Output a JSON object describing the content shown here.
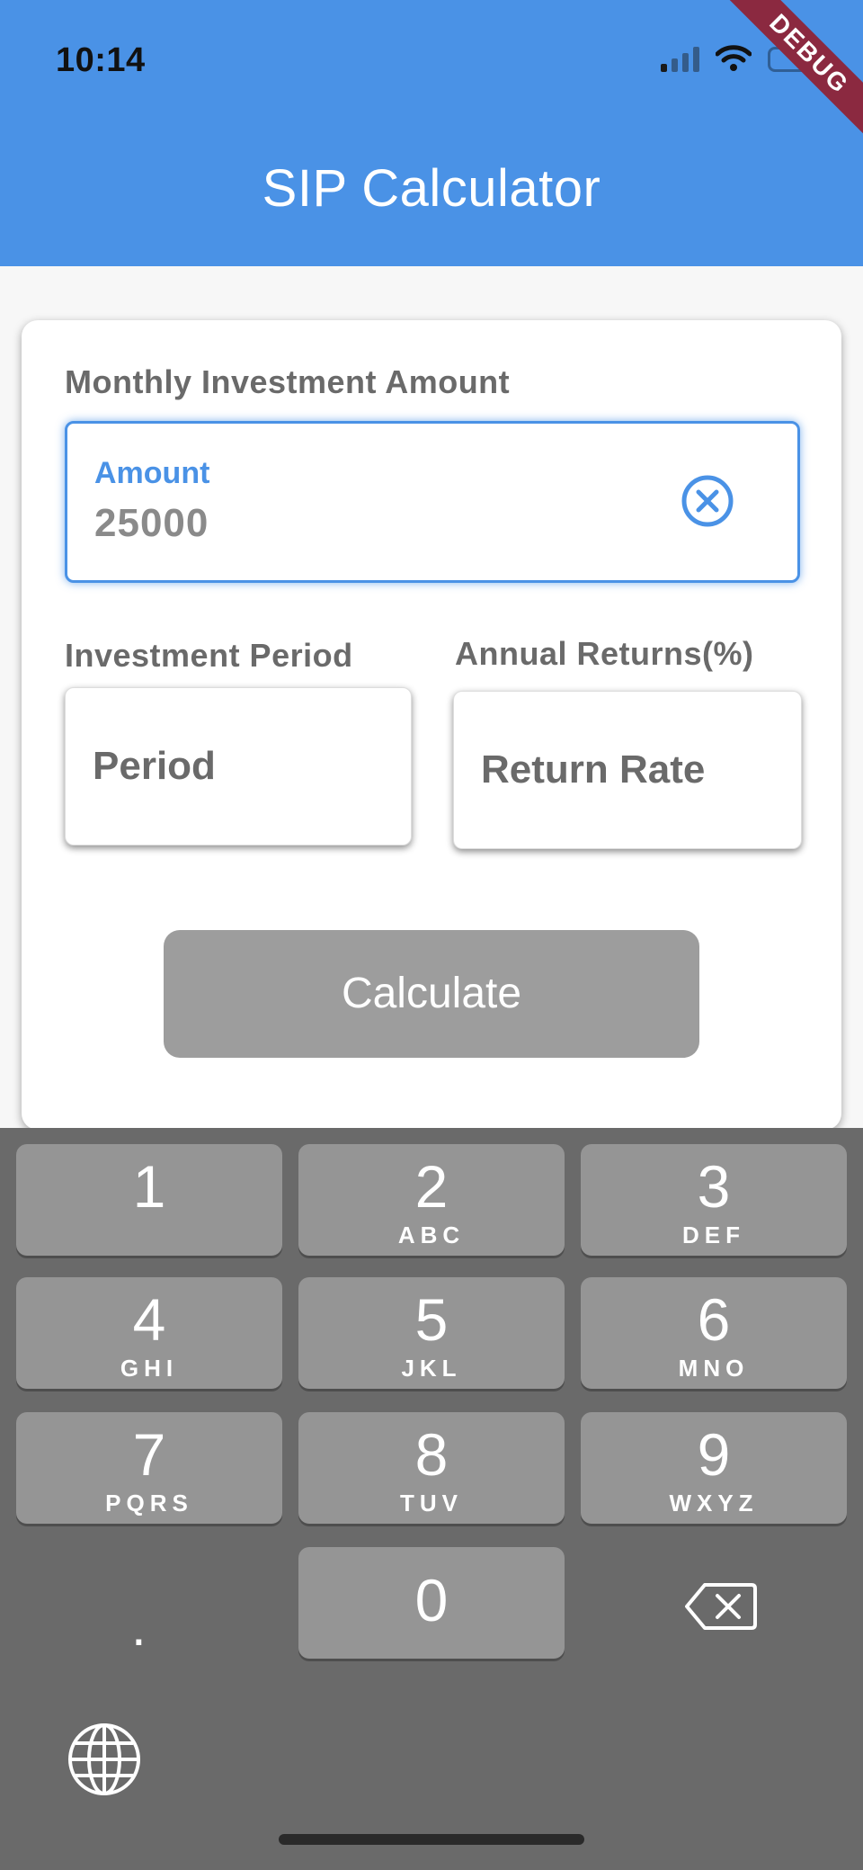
{
  "status_bar": {
    "time": "10:14"
  },
  "debug_banner": "DEBUG",
  "app_bar": {
    "title": "SIP Calculator"
  },
  "form": {
    "monthly_label": "Monthly Investment Amount",
    "amount_field": {
      "label": "Amount",
      "value": "25000"
    },
    "period_label": "Investment Period",
    "period_field": {
      "placeholder": "Period"
    },
    "returns_label": "Annual Returns(%)",
    "returns_field": {
      "placeholder": "Return Rate"
    },
    "calculate_label": "Calculate"
  },
  "keyboard": {
    "keys": [
      {
        "digit": "1",
        "letters": ""
      },
      {
        "digit": "2",
        "letters": "ABC"
      },
      {
        "digit": "3",
        "letters": "DEF"
      },
      {
        "digit": "4",
        "letters": "GHI"
      },
      {
        "digit": "5",
        "letters": "JKL"
      },
      {
        "digit": "6",
        "letters": "MNO"
      },
      {
        "digit": "7",
        "letters": "PQRS"
      },
      {
        "digit": "8",
        "letters": "TUV"
      },
      {
        "digit": "9",
        "letters": "WXYZ"
      },
      {
        "digit": "0",
        "letters": ""
      }
    ],
    "decimal": "."
  },
  "colors": {
    "app_bar": "#4a92e6",
    "accent": "#4a92e6",
    "button_disabled": "#9d9d9d",
    "keyboard_bg": "#6a6a6a",
    "key_bg": "#959595"
  }
}
